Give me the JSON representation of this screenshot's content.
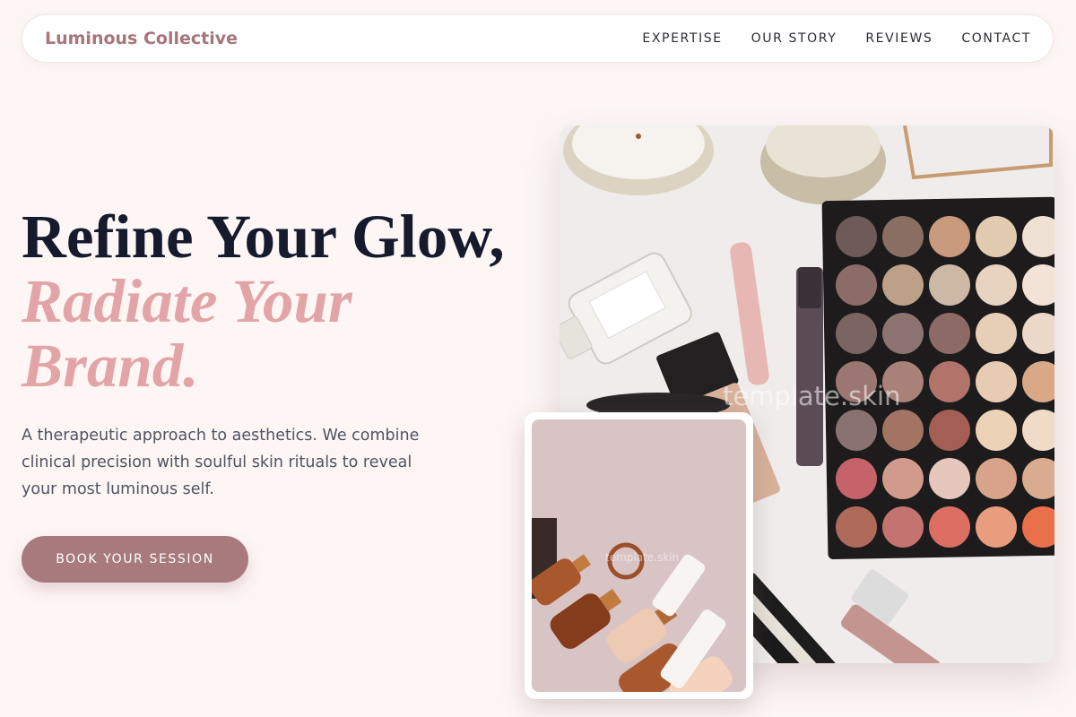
{
  "brand": {
    "name": "Luminous Collective"
  },
  "nav": {
    "items": [
      "EXPERTISE",
      "OUR STORY",
      "REVIEWS",
      "CONTACT"
    ]
  },
  "hero": {
    "line1": "Refine Your Glow,",
    "line2": "Radiate Your",
    "line3": "Brand.",
    "description": "A therapeutic approach to aesthetics. We combine clinical precision with soulful skin rituals to reveal your most luminous self.",
    "cta": "BOOK YOUR SESSION"
  },
  "images": {
    "watermark": "template.skin",
    "main_alt": "Flat lay of makeup palette, candles and cosmetics",
    "card_alt": "Amber glass skincare bottles on pink background"
  },
  "colors": {
    "background": "#fdf6f5",
    "brand": "#a7757a",
    "accent": "#e3a4a7",
    "heading": "#151a2d",
    "button": "#a87a7d"
  }
}
